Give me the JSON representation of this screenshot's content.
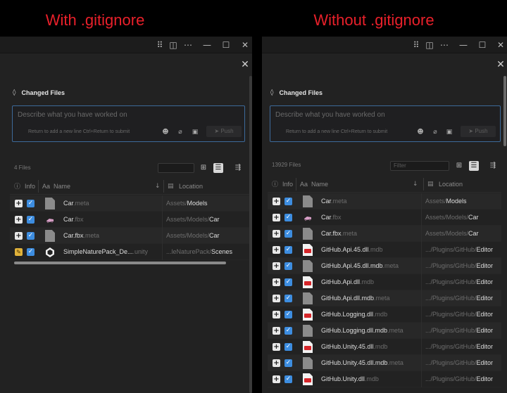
{
  "captions": {
    "left": "With .gitignore",
    "right": "Without .gitignore"
  },
  "colors": {
    "caption_red": "#e8202a",
    "accent_blue": "#3d8de0",
    "input_border": "#3d6a9a",
    "background": "#222222"
  },
  "common": {
    "header_title": "Changed Files",
    "description_placeholder": "Describe what you have worked on",
    "hint_text": "Return to add a new line   Ctrl+Return to submit",
    "push_label": "Push",
    "col_info": "Info",
    "col_name_prefix": "Aa",
    "col_name": "Name",
    "col_location": "Location",
    "sort_arrow": "↓"
  },
  "left": {
    "file_count": "4 Files",
    "filter_placeholder": "",
    "rows": [
      {
        "name": "Car",
        "ext": ".meta",
        "dir": "Assets/",
        "last": "Models",
        "icon": "doc-icon",
        "status": "added"
      },
      {
        "name": "Car",
        "ext": ".fbx",
        "dir": "Assets/Models/",
        "last": "Car",
        "icon": "fbx-icon",
        "status": "added"
      },
      {
        "name": "Car.fbx",
        "ext": ".meta",
        "dir": "Assets/Models/",
        "last": "Car",
        "icon": "doc-icon",
        "status": "added"
      },
      {
        "name": "SimpleNaturePack_De...",
        "ext": ".unity",
        "dir": "...leNaturePack/",
        "last": "Scenes",
        "icon": "unity-icon",
        "status": "modified"
      }
    ]
  },
  "right": {
    "file_count": "13929 Files",
    "filter_placeholder": "Filter",
    "rows": [
      {
        "name": "Car",
        "ext": ".meta",
        "dir": "Assets/",
        "last": "Models",
        "icon": "doc-icon",
        "status": "added"
      },
      {
        "name": "Car",
        "ext": ".fbx",
        "dir": "Assets/Models/",
        "last": "Car",
        "icon": "fbx-icon",
        "status": "added"
      },
      {
        "name": "Car.fbx",
        "ext": ".meta",
        "dir": "Assets/Models/",
        "last": "Car",
        "icon": "doc-icon",
        "status": "added"
      },
      {
        "name": "GitHub.Api.45.dll",
        "ext": ".mdb",
        "dir": ".../Plugins/GitHub/",
        "last": "Editor",
        "icon": "dll-icon",
        "status": "added"
      },
      {
        "name": "GitHub.Api.45.dll.mdb",
        "ext": ".meta",
        "dir": ".../Plugins/GitHub/",
        "last": "Editor",
        "icon": "doc-icon",
        "status": "added"
      },
      {
        "name": "GitHub.Api.dll",
        "ext": ".mdb",
        "dir": ".../Plugins/GitHub/",
        "last": "Editor",
        "icon": "dll-icon",
        "status": "added"
      },
      {
        "name": "GitHub.Api.dll.mdb",
        "ext": ".meta",
        "dir": ".../Plugins/GitHub/",
        "last": "Editor",
        "icon": "doc-icon",
        "status": "added"
      },
      {
        "name": "GitHub.Logging.dll",
        "ext": ".mdb",
        "dir": ".../Plugins/GitHub/",
        "last": "Editor",
        "icon": "dll-icon",
        "status": "added"
      },
      {
        "name": "GitHub.Logging.dll.mdb",
        "ext": ".meta",
        "dir": ".../Plugins/GitHub/",
        "last": "Editor",
        "icon": "doc-icon",
        "status": "added"
      },
      {
        "name": "GitHub.Unity.45.dll",
        "ext": ".mdb",
        "dir": ".../Plugins/GitHub/",
        "last": "Editor",
        "icon": "dll-icon",
        "status": "added"
      },
      {
        "name": "GitHub.Unity.45.dll.mdb",
        "ext": ".meta",
        "dir": ".../Plugins/GitHub/",
        "last": "Editor",
        "icon": "doc-icon",
        "status": "added"
      },
      {
        "name": "GitHub.Unity.dll",
        "ext": ".mdb",
        "dir": ".../Plugins/GitHub/",
        "last": "Editor",
        "icon": "dll-icon",
        "status": "added"
      }
    ]
  }
}
